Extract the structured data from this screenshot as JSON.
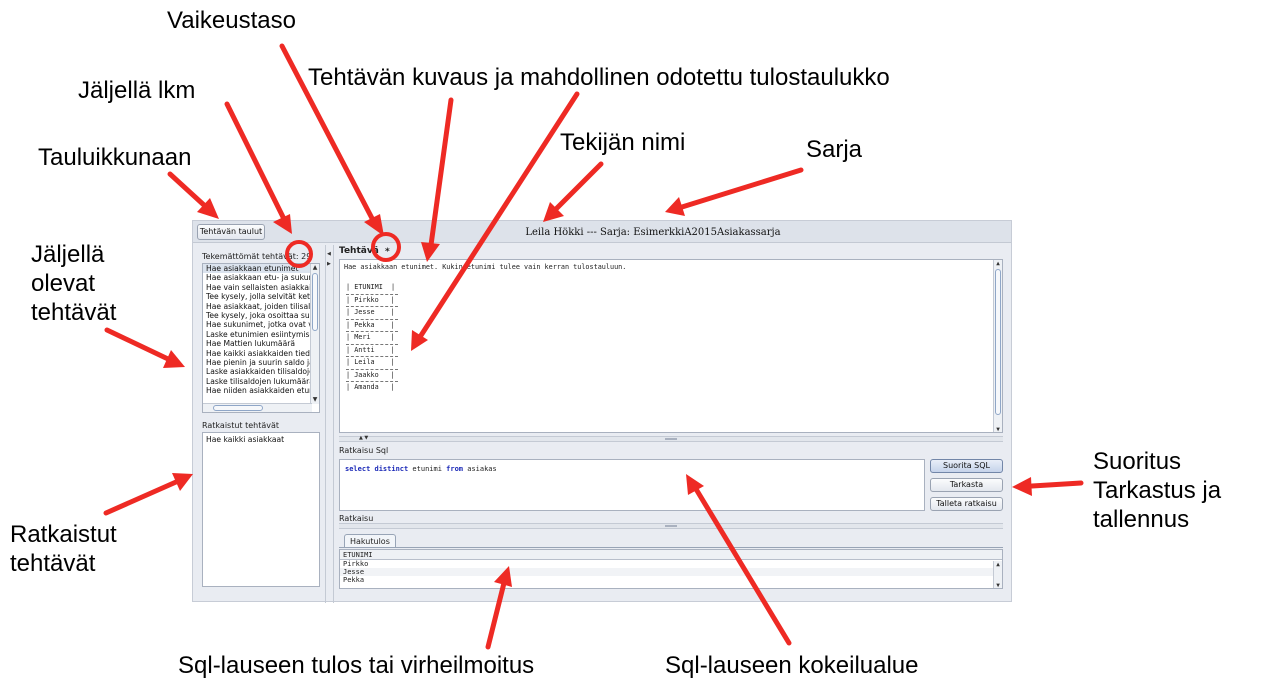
{
  "callouts": {
    "vaikeustaso": "Vaikeustaso",
    "jaljella_lkm": "Jäljellä lkm",
    "kuvaus": "Tehtävän kuvaus ja mahdollinen odotettu tulostaulukko",
    "tekija": "Tekijän nimi",
    "sarja": "Sarja",
    "tauluikkunaan": "Tauluikkunaan",
    "jaljella_olevat": "Jäljellä\nolevat\ntehtävät",
    "ratkaistut": "Ratkaistut\ntehtävät",
    "suoritus": "Suoritus\nTarkastus ja\ntallennus",
    "sql_tulos": "Sql-lauseen tulos tai virheilmoitus",
    "sql_kokeilu": "Sql-lauseen kokeilualue"
  },
  "app": {
    "tables_button": "Tehtävän taulut",
    "window_title": "Leila Hökki --- Sarja: EsimerkkiA2015Asiakassarja",
    "unsolved_label": "Tekemättömät tehtävät: 29",
    "unsolved": [
      "Hae asiakkaan etunimet",
      "Hae asiakkaan etu- ja sukunimet",
      "Hae vain sellaisten asiakkaiden",
      "Tee kysely, jolla selvität ket",
      "Hae asiakkaat, joiden tilisaldo",
      "Tee kysely, joka osoittaa sukunimet",
      "Hae sukunimet, jotka ovat vain",
      "Laske etunimien esiintymiset",
      "Hae Mattien lukumäärä",
      "Hae kaikki asiakkaiden tiedot",
      "Hae pienin ja suurin saldo ja",
      "Laske asiakkaiden tilisaldojen",
      "Laske tilisaldojen lukumäärä",
      "Hae niiden asiakkaiden etunimet"
    ],
    "solved_label": "Ratkaistut tehtävät",
    "solved": [
      "Hae kaikki asiakkaat"
    ],
    "task_label": "Tehtävä",
    "difficulty": "*",
    "task_description": "Hae asiakkaan etunimet. Kukin etunimi tulee vain kerran tulostauluun.",
    "expected": {
      "header": "ETUNIMI",
      "rows": [
        "Pirkko",
        "Jesse",
        "Pekka",
        "Meri",
        "Antti",
        "Leila",
        "Jaakko",
        "Amanda"
      ]
    },
    "sql_label": "Ratkaisu Sql",
    "sql": {
      "kw1": "select distinct",
      "mid": " etunimi ",
      "kw2": "from",
      "tail": " asiakas"
    },
    "run_button": "Suorita SQL",
    "check_button": "Tarkasta",
    "save_button": "Talleta ratkaisu",
    "result_label": "Ratkaisu",
    "result_tab": "Hakutulos",
    "result_header": "ETUNIMI",
    "result_rows": [
      "Pirkko",
      "Jesse",
      "Pekka"
    ]
  }
}
